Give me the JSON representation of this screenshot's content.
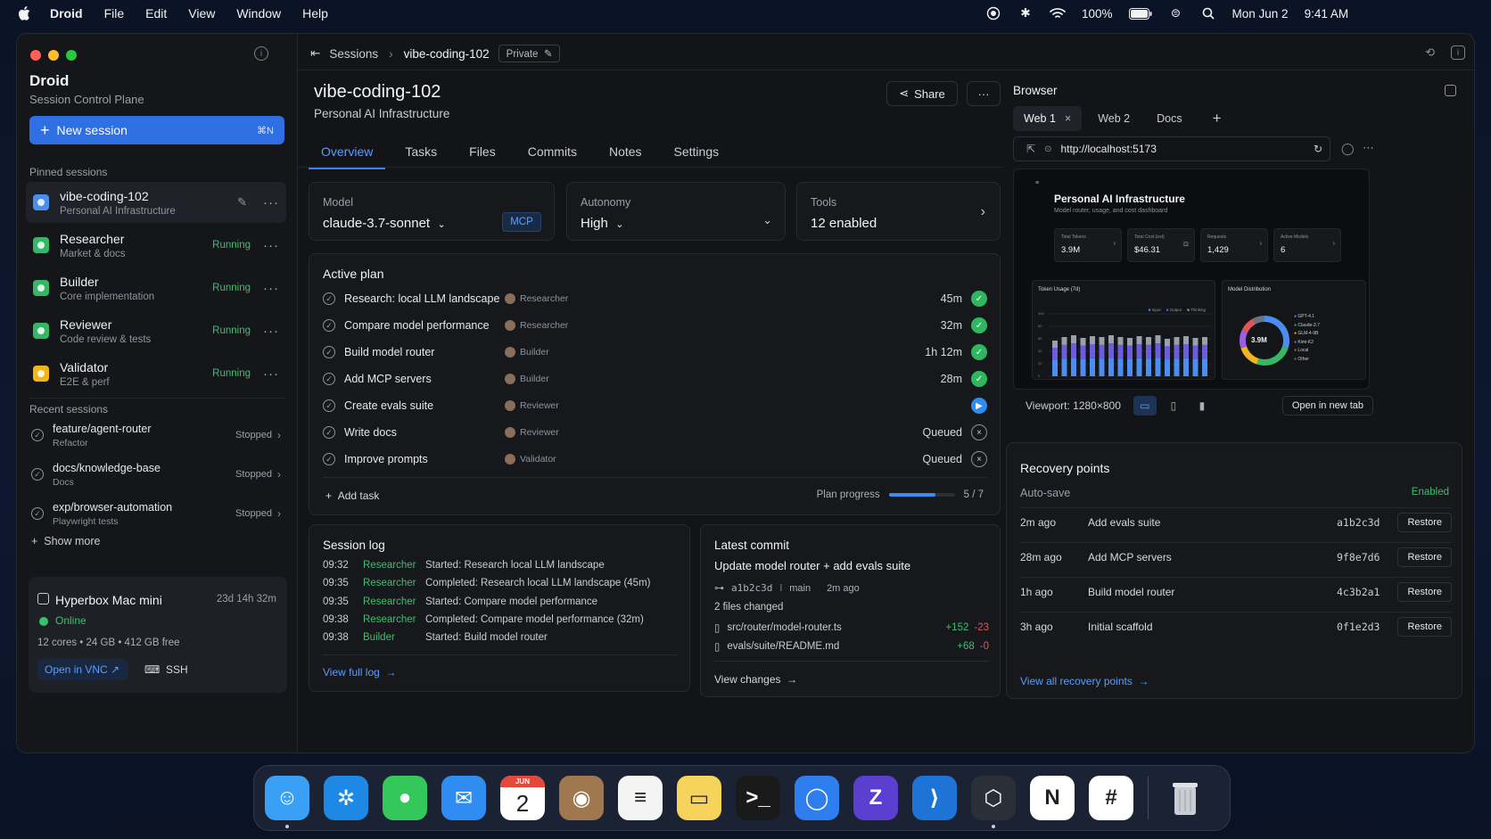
{
  "menubar": {
    "app": "Droid",
    "menus": [
      "File",
      "Edit",
      "View",
      "Window",
      "Help"
    ],
    "battery": "100%",
    "date": "Mon Jun 2",
    "time": "9:41 AM"
  },
  "sidebar": {
    "title": "Droid",
    "subtitle": "Session Control Plane",
    "new_session": "New session",
    "new_session_kbd": "⌘N",
    "pinned_label": "Pinned sessions",
    "pinned": [
      {
        "name": "vibe-coding-102",
        "desc": "Personal AI Infrastructure",
        "status": "",
        "color": "#4b8ef0"
      },
      {
        "name": "Researcher",
        "desc": "Market & docs",
        "status": "Running",
        "color": "#35b765"
      },
      {
        "name": "Builder",
        "desc": "Core implementation",
        "status": "Running",
        "color": "#35b765"
      },
      {
        "name": "Reviewer",
        "desc": "Code review & tests",
        "status": "Running",
        "color": "#35b765"
      },
      {
        "name": "Validator",
        "desc": "E2E & perf",
        "status": "Running",
        "color": "#f0b41c"
      }
    ],
    "recent_label": "Recent sessions",
    "recent": [
      {
        "name": "feature/agent-router",
        "desc": "Refactor",
        "status": "Stopped"
      },
      {
        "name": "docs/knowledge-base",
        "desc": "Docs",
        "status": "Stopped"
      },
      {
        "name": "exp/browser-automation",
        "desc": "Playwright tests",
        "status": "Stopped"
      }
    ],
    "show_more": "Show more",
    "host": {
      "name": "Hyperbox Mac mini",
      "uptime": "23d 14h 32m",
      "status": "Online",
      "specs": "12 cores  •  24 GB  •  412 GB free",
      "vnc": "Open in VNC ↗",
      "ssh": "SSH"
    }
  },
  "header": {
    "crumb_root": "Sessions",
    "crumb_current": "vibe-coding-102",
    "visibility": "Private",
    "title": "vibe-coding-102",
    "subtitle": "Personal AI Infrastructure",
    "share": "Share"
  },
  "tabs": [
    "Overview",
    "Tasks",
    "Files",
    "Commits",
    "Notes",
    "Settings"
  ],
  "model": {
    "label": "Model",
    "value": "claude-3.7-sonnet",
    "badge": "MCP"
  },
  "autonomy": {
    "label": "Autonomy",
    "value": "High"
  },
  "tools": {
    "label": "Tools",
    "value": "12 enabled"
  },
  "plan": {
    "title": "Active plan",
    "tasks": [
      {
        "name": "Research: local LLM landscape",
        "agent": "Researcher",
        "time": "45m",
        "state": "done"
      },
      {
        "name": "Compare model performance",
        "agent": "Researcher",
        "time": "32m",
        "state": "done"
      },
      {
        "name": "Build model router",
        "agent": "Builder",
        "time": "1h 12m",
        "state": "done"
      },
      {
        "name": "Add MCP servers",
        "agent": "Builder",
        "time": "28m",
        "state": "done"
      },
      {
        "name": "Create evals suite",
        "agent": "Reviewer",
        "time": "",
        "state": "running"
      },
      {
        "name": "Write docs",
        "agent": "Reviewer",
        "time": "Queued",
        "state": "queued"
      },
      {
        "name": "Improve prompts",
        "agent": "Validator",
        "time": "Queued",
        "state": "queued"
      }
    ],
    "add_task": "Add task",
    "progress_label": "Plan progress",
    "progress_text": "5 / 7",
    "progress_fraction": 0.71
  },
  "log": {
    "title": "Session log",
    "entries": [
      {
        "time": "09:32",
        "who": "Researcher",
        "event": "Started: Research local LLM landscape"
      },
      {
        "time": "09:35",
        "who": "Researcher",
        "event": "Completed: Research local LLM landscape (45m)"
      },
      {
        "time": "09:35",
        "who": "Researcher",
        "event": "Started: Compare model performance"
      },
      {
        "time": "09:38",
        "who": "Researcher",
        "event": "Completed: Compare model performance (32m)"
      },
      {
        "time": "09:38",
        "who": "Builder",
        "event": "Started: Build model router"
      }
    ],
    "view_full": "View full log"
  },
  "commit": {
    "title": "Latest commit",
    "message": "Update model router + add evals suite",
    "hash": "a1b2c3d",
    "branch": "main",
    "ago": "2m ago",
    "files_changed": "2 files changed",
    "files": [
      {
        "path": "src/router/model-router.ts",
        "add": "+152",
        "del": "-23"
      },
      {
        "path": "evals/suite/README.md",
        "add": "+68",
        "del": "-0"
      }
    ],
    "view_changes": "View changes"
  },
  "browser": {
    "title": "Browser",
    "tabs": [
      "Web 1",
      "Web 2",
      "Docs"
    ],
    "url": "http://localhost:5173",
    "viewport_label": "Viewport:",
    "viewport": "1280×800",
    "open_new_tab": "Open in new tab",
    "preview": {
      "title": "Personal AI Infrastructure",
      "subtitle": "Model router, usage, and cost dashboard",
      "kpis": [
        {
          "label": "Total Tokens",
          "value": "3.9M"
        },
        {
          "label": "Total Cost (est)",
          "value": "$46.31"
        },
        {
          "label": "Requests",
          "value": "1,429"
        },
        {
          "label": "Active Models",
          "value": "6"
        }
      ],
      "usage_title": "Token Usage (7d)",
      "usage_legend": [
        "Input",
        "Output",
        "Thinking"
      ],
      "dist_title": "Model Distribution",
      "dist_center": "3.9M",
      "dist_legend": [
        "GPT-4.1",
        "Claude-3.7",
        "GLM-4-9B",
        "Kimi-K2",
        "Local",
        "Other"
      ],
      "dist_colors": [
        "#4b8ef0",
        "#35b765",
        "#f0b41c",
        "#9b5de5",
        "#e05656",
        "#6b7280"
      ]
    }
  },
  "recovery": {
    "title": "Recovery points",
    "autosave": "Auto-save",
    "autosave_state": "Enabled",
    "points": [
      {
        "ago": "2m ago",
        "desc": "Add evals suite",
        "hash": "a1b2c3d",
        "action": "Restore"
      },
      {
        "ago": "28m ago",
        "desc": "Add MCP servers",
        "hash": "9f8e7d6",
        "action": "Restore"
      },
      {
        "ago": "1h ago",
        "desc": "Build model router",
        "hash": "4c3b2a1",
        "action": "Restore"
      },
      {
        "ago": "3h ago",
        "desc": "Initial scaffold",
        "hash": "0f1e2d3",
        "action": "Restore"
      }
    ],
    "view_all": "View all recovery points"
  },
  "dock": {
    "apps": [
      {
        "name": "finder",
        "color": "#3aa0f5",
        "glyph": "☺"
      },
      {
        "name": "safari",
        "color": "#1e88e5",
        "glyph": "✲"
      },
      {
        "name": "messages",
        "color": "#34c759",
        "glyph": "●"
      },
      {
        "name": "mail",
        "color": "#2f8cf0",
        "glyph": "✉"
      },
      {
        "name": "calendar",
        "color": "#ffffff",
        "glyph": "2"
      },
      {
        "name": "contacts",
        "color": "#a07850",
        "glyph": "◉"
      },
      {
        "name": "reminders",
        "color": "#f4f4f4",
        "glyph": "≡"
      },
      {
        "name": "notes",
        "color": "#f6d35a",
        "glyph": "▭"
      },
      {
        "name": "terminal",
        "color": "#1a1a1a",
        "glyph": ">_"
      },
      {
        "name": "user",
        "color": "#2f7ef0",
        "glyph": "◯"
      },
      {
        "name": "zed",
        "color": "#5b3fd0",
        "glyph": "Z"
      },
      {
        "name": "vscode",
        "color": "#1d74d6",
        "glyph": "⟩"
      },
      {
        "name": "cube",
        "color": "#2a2f38",
        "glyph": "⬡"
      },
      {
        "name": "notion",
        "color": "#ffffff",
        "glyph": "N"
      },
      {
        "name": "slack",
        "color": "#ffffff",
        "glyph": "#"
      }
    ],
    "calendar_month": "JUN"
  }
}
